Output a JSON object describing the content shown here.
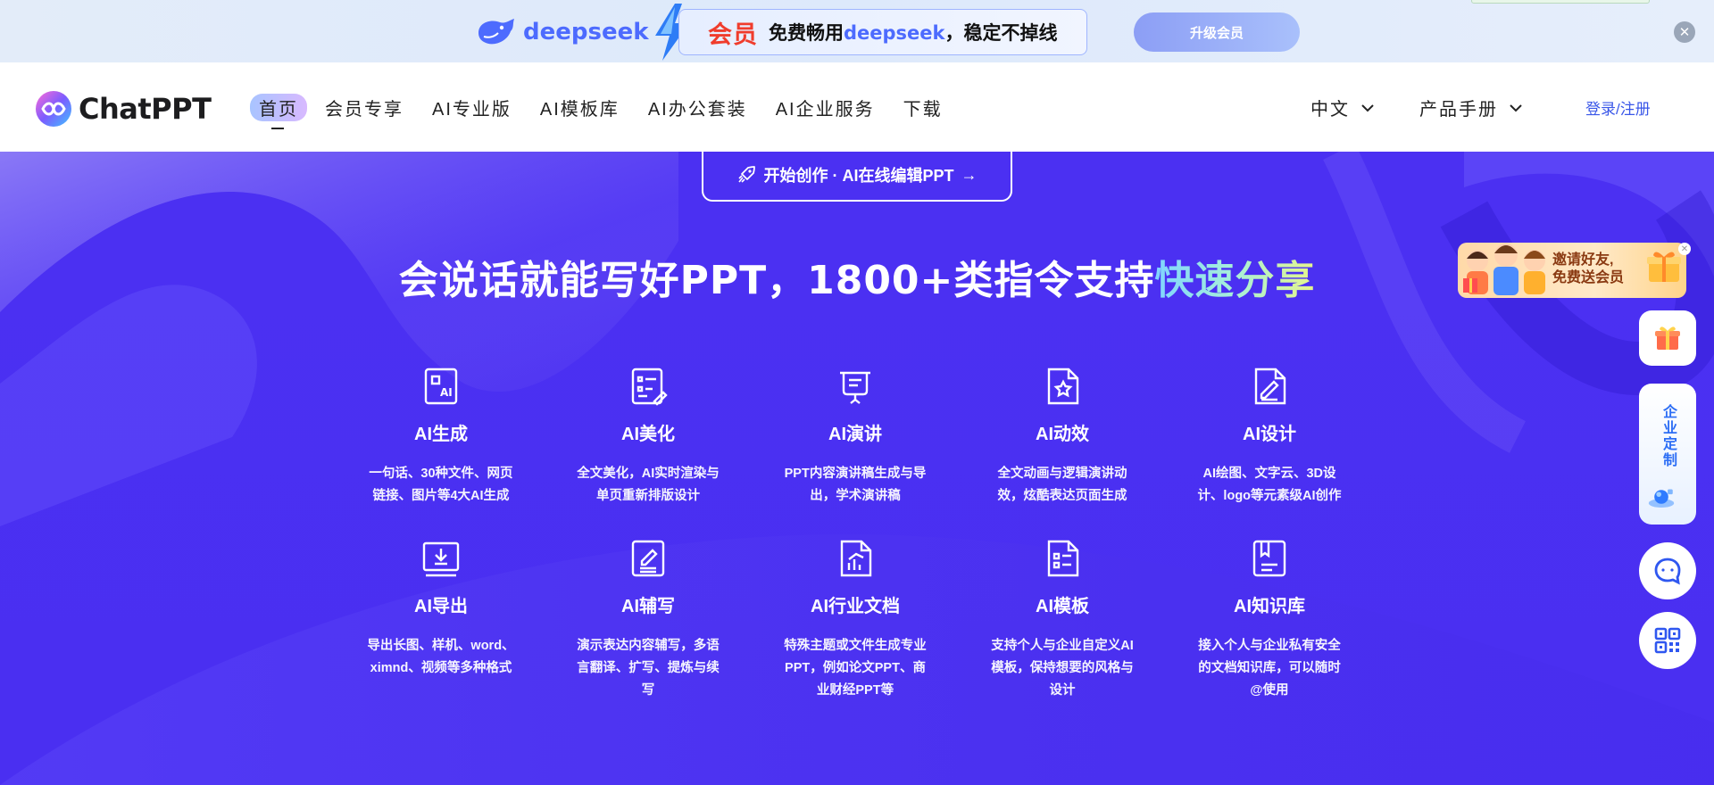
{
  "promo": {
    "brand": "deepseek",
    "vip": "会员",
    "text_prefix": "免费畅用",
    "text_brand": "deepseek",
    "text_suffix": "，稳定不掉线",
    "upgrade_label": "升级会员",
    "close_icon": "close-icon"
  },
  "header": {
    "logo_text": "ChatPPT",
    "nav": [
      "首页",
      "会员专享",
      "AI专业版",
      "AI模板库",
      "AI办公套装",
      "AI企业服务",
      "下载"
    ],
    "language": "中文",
    "manual": "产品手册",
    "login": "登录/注册"
  },
  "hero": {
    "cta_label": "开始创作 · AI在线编辑PPT",
    "headline_main": "会说话就能写好PPT，1800+类指令支持",
    "headline_highlight": "快速分享",
    "accent_color": "#4a2ff0"
  },
  "features": [
    {
      "title": "AI生成",
      "desc": "一句话、30种文件、网页链接、图片等4大AI生成",
      "icon": "ppt-ai-icon"
    },
    {
      "title": "AI美化",
      "desc": "全文美化，AI实时渲染与单页重新排版设计",
      "icon": "beautify-icon"
    },
    {
      "title": "AI演讲",
      "desc": "PPT内容演讲稿生成与导出，学术演讲稿",
      "icon": "speech-icon"
    },
    {
      "title": "AI动效",
      "desc": "全文动画与逻辑演讲动效，炫酷表达页面生成",
      "icon": "animation-icon"
    },
    {
      "title": "AI设计",
      "desc": "AI绘图、文字云、3D设计、logo等元素级AI创作",
      "icon": "design-icon"
    },
    {
      "title": "AI导出",
      "desc": "导出长图、样机、word、ximnd、视频等多种格式",
      "icon": "export-icon"
    },
    {
      "title": "AI辅写",
      "desc": "演示表达内容辅写，多语言翻译、扩写、提炼与续写",
      "icon": "writing-icon"
    },
    {
      "title": "AI行业文档",
      "desc": "特殊主题或文件生成专业PPT，例如论文PPT、商业财经PPT等",
      "icon": "industry-doc-icon"
    },
    {
      "title": "AI模板",
      "desc": "支持个人与企业自定义AI模板，保持想要的风格与设计",
      "icon": "template-icon"
    },
    {
      "title": "AI知识库",
      "desc": "接入个人与企业私有安全的文档知识库，可以随时@使用",
      "icon": "knowledge-base-icon"
    }
  ],
  "sidebar": {
    "invite_line1": "邀请好友,",
    "invite_line2": "免费送会员",
    "enterprise": "企业定制"
  }
}
